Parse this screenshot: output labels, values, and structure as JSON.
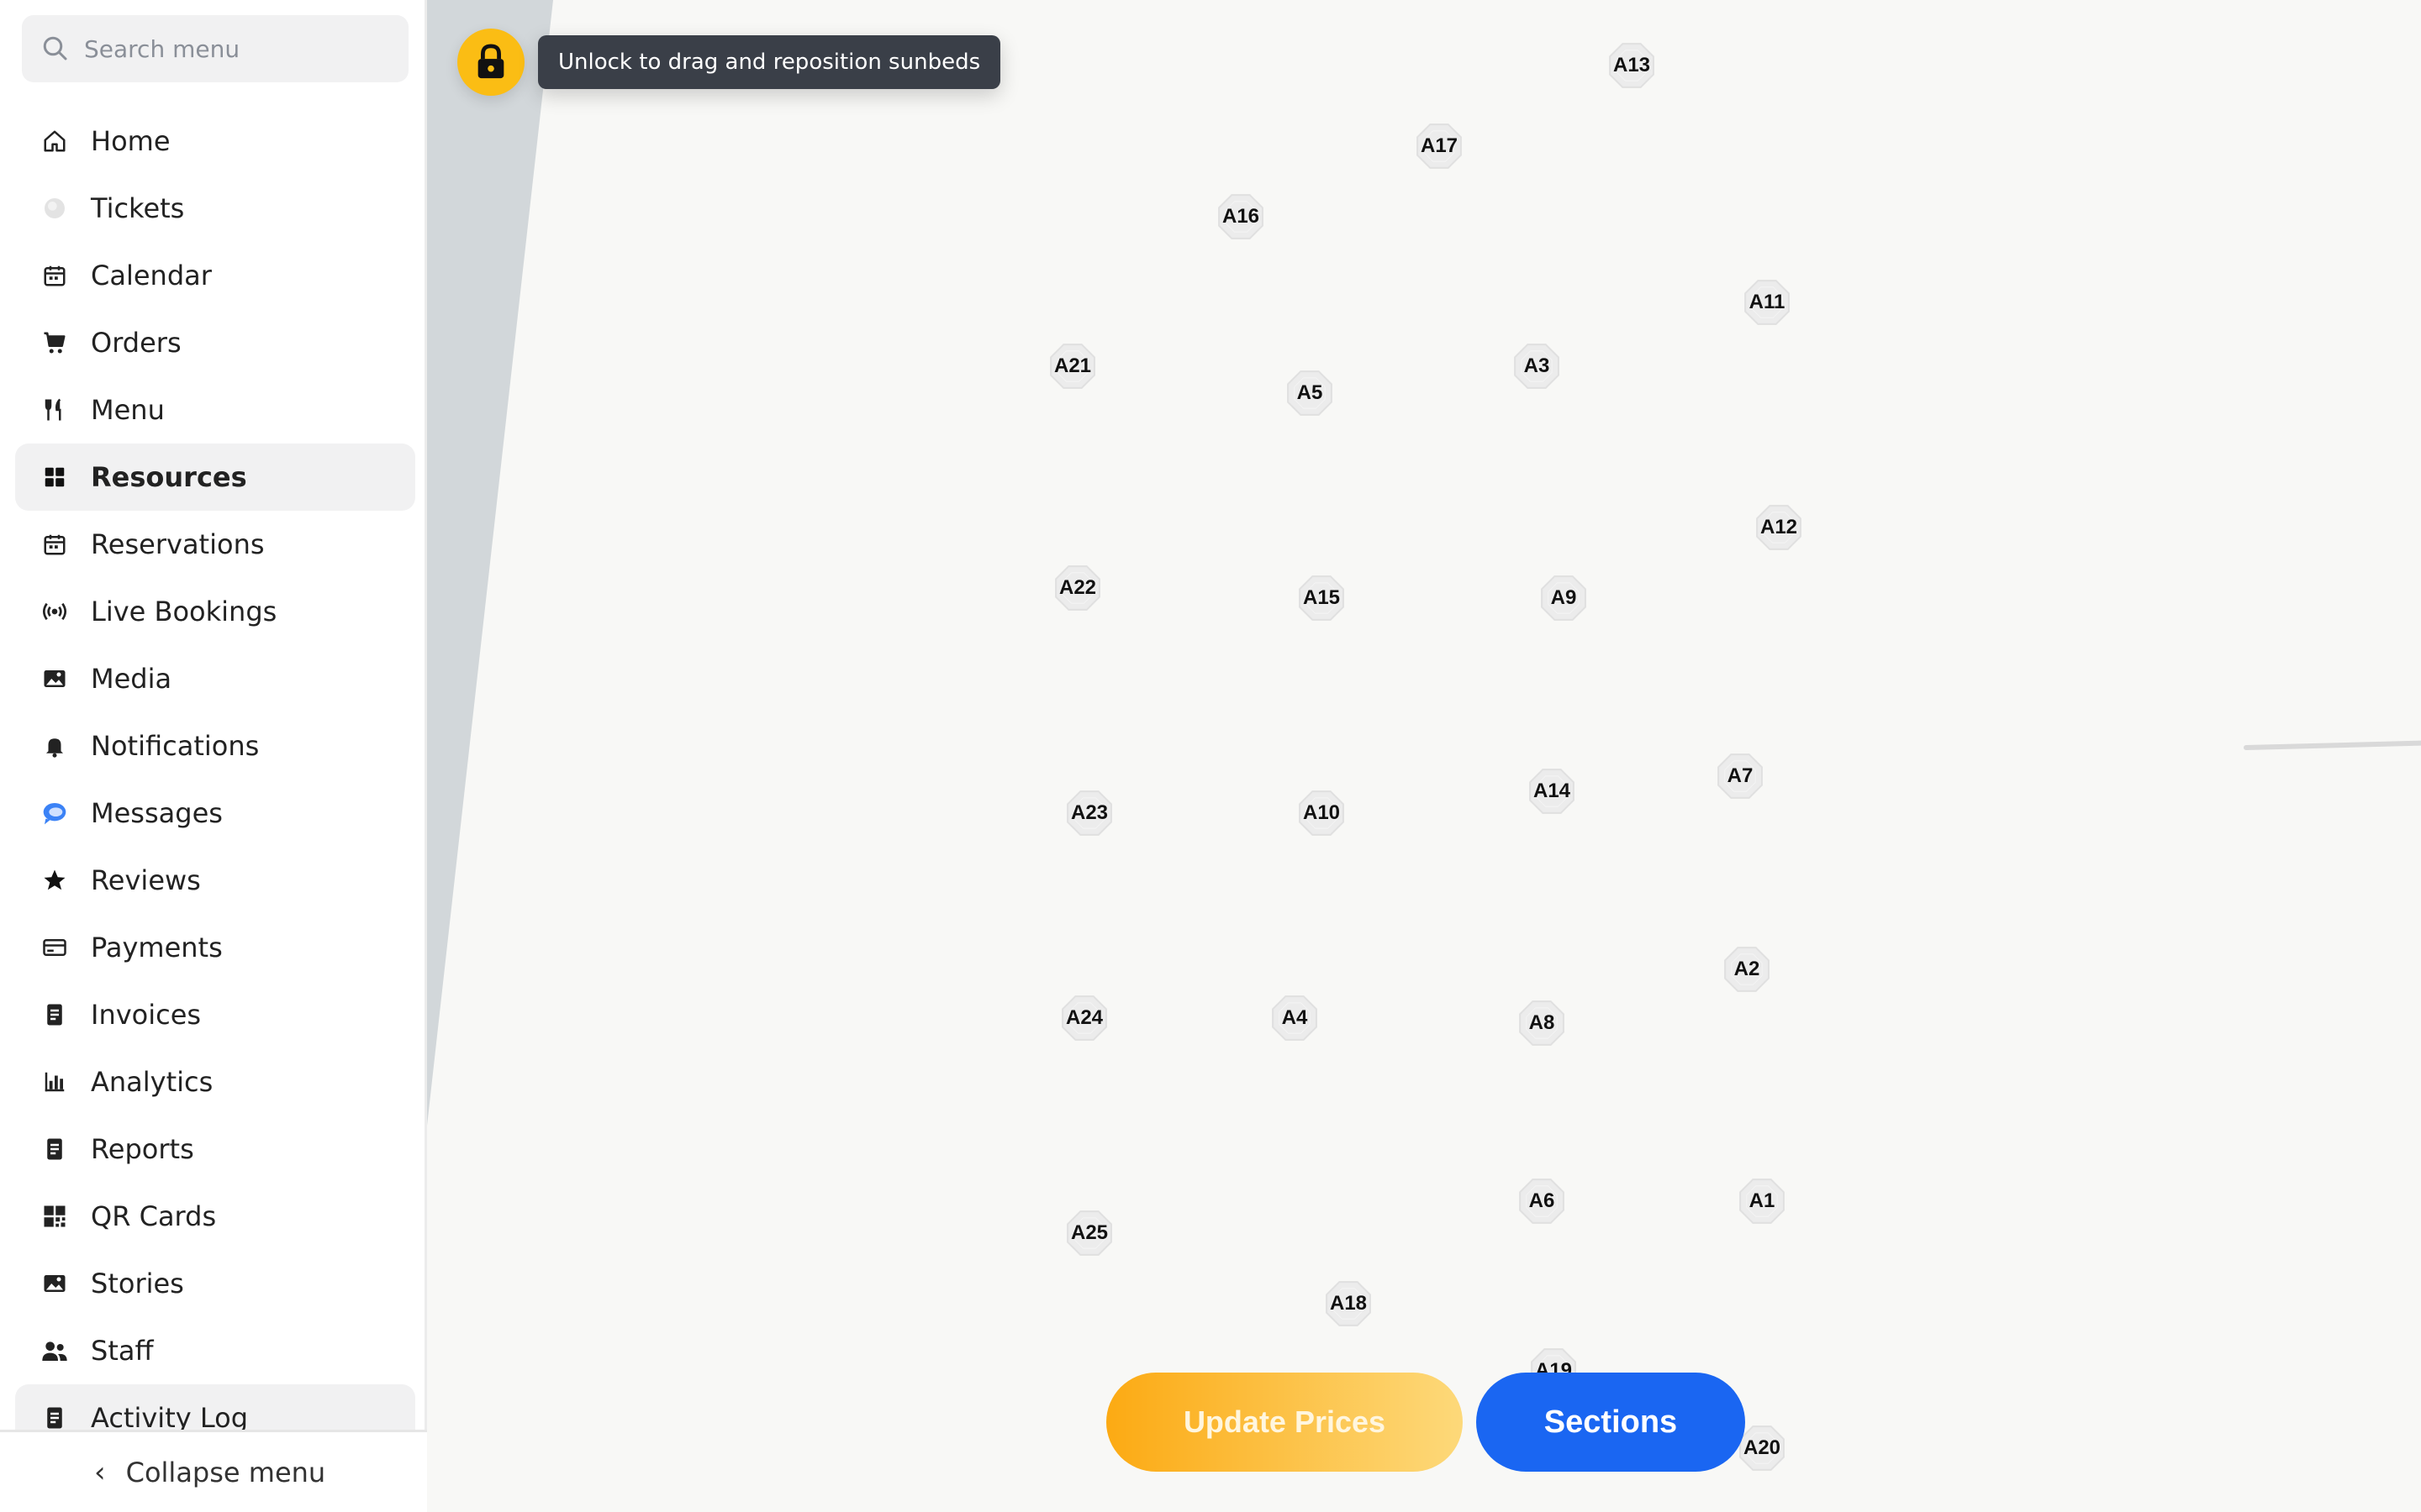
{
  "sidebar": {
    "search_placeholder": "Search menu",
    "items": [
      {
        "label": "Home",
        "icon": "home-icon"
      },
      {
        "label": "Tickets",
        "icon": "tickets-icon"
      },
      {
        "label": "Calendar",
        "icon": "calendar-icon"
      },
      {
        "label": "Orders",
        "icon": "cart-icon"
      },
      {
        "label": "Menu",
        "icon": "utensils-icon"
      },
      {
        "label": "Resources",
        "icon": "grid-icon",
        "active": true
      },
      {
        "label": "Reservations",
        "icon": "calendar-icon"
      },
      {
        "label": "Live Bookings",
        "icon": "broadcast-icon"
      },
      {
        "label": "Media",
        "icon": "image-icon"
      },
      {
        "label": "Notifications",
        "icon": "bell-icon"
      },
      {
        "label": "Messages",
        "icon": "chat-icon"
      },
      {
        "label": "Reviews",
        "icon": "star-icon"
      },
      {
        "label": "Payments",
        "icon": "card-icon"
      },
      {
        "label": "Invoices",
        "icon": "document-icon"
      },
      {
        "label": "Analytics",
        "icon": "bar-chart-icon"
      },
      {
        "label": "Reports",
        "icon": "document-icon"
      },
      {
        "label": "QR Cards",
        "icon": "qr-icon"
      },
      {
        "label": "Stories",
        "icon": "image-icon"
      },
      {
        "label": "Staff",
        "icon": "people-icon"
      },
      {
        "label": "Activity Log",
        "icon": "document-icon"
      }
    ],
    "collapse_label": "Collapse menu"
  },
  "map": {
    "lock_tooltip": "Unlock to drag and reposition sunbeds",
    "sunbeds": [
      "A13",
      "A17",
      "A16",
      "A11",
      "A21",
      "A5",
      "A3",
      "A12",
      "A22",
      "A15",
      "A9",
      "A7",
      "A23",
      "A10",
      "A14",
      "A2",
      "A24",
      "A4",
      "A8",
      "A6",
      "A1",
      "A25",
      "A18",
      "A19",
      "A20"
    ]
  },
  "actions": {
    "update_prices": "Update Prices",
    "sections": "Sections"
  },
  "colors": {
    "accent_yellow": "#fbbd14",
    "accent_blue": "#1a66f2",
    "tooltip_bg": "#3a3f48"
  }
}
